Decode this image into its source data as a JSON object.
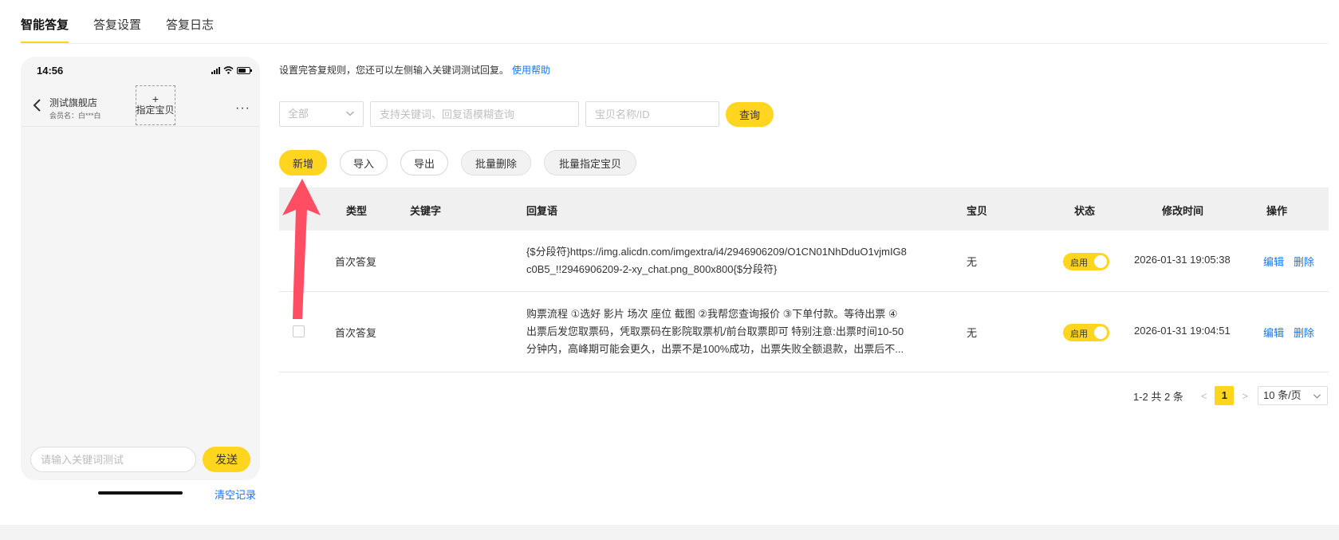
{
  "tabs": [
    {
      "label": "智能答复",
      "active": true
    },
    {
      "label": "答复设置",
      "active": false
    },
    {
      "label": "答复日志",
      "active": false
    }
  ],
  "phone": {
    "time": "14:56",
    "shop_name": "测试旗舰店",
    "member": "会员名：白***白",
    "assign_plus": "+",
    "assign_label": "指定宝贝",
    "more": "···",
    "input_placeholder": "请输入关键词测试",
    "send_label": "发送",
    "clear_label": "清空记录"
  },
  "main": {
    "description": "设置完答复规则，您还可以左侧输入关键词测试回复。",
    "help_link": "使用帮助",
    "filter": {
      "type_select": "全部",
      "keyword_placeholder": "支持关键词、回复语模糊查询",
      "item_placeholder": "宝贝名称/ID",
      "query_label": "查询"
    },
    "actions": {
      "add": "新增",
      "import": "导入",
      "export": "导出",
      "batch_delete": "批量删除",
      "batch_assign": "批量指定宝贝"
    },
    "table": {
      "headers": {
        "type": "类型",
        "keyword": "关键字",
        "reply": "回复语",
        "item": "宝贝",
        "status": "状态",
        "modified": "修改时间",
        "ops": "操作"
      },
      "rows": [
        {
          "type": "首次答复",
          "keyword": "",
          "reply_lines": [
            "{$分段符}https://img.alicdn.com/imgextra/i4/2946906209/O1CN01NhDduO1vjmIG8",
            "c0B5_!!2946906209-2-xy_chat.png_800x800{$分段符}"
          ],
          "item": "无",
          "status": "启用",
          "modified": "2026-01-31 19:05:38",
          "edit": "编辑",
          "delete": "删除"
        },
        {
          "type": "首次答复",
          "keyword": "",
          "reply_lines": [
            "购票流程 ①选好 影片 场次 座位 截图 ②我帮您查询报价 ③下单付款。等待出票 ④",
            "出票后发您取票码，凭取票码在影院取票机/前台取票即可 特别注意:出票时间10-50",
            "分钟内，高峰期可能会更久，出票不是100%成功，出票失败全额退款，出票后不..."
          ],
          "item": "无",
          "status": "启用",
          "modified": "2026-01-31 19:04:51",
          "edit": "编辑",
          "delete": "删除"
        }
      ]
    },
    "pagination": {
      "total": "1-2 共 2 条",
      "prev": "<",
      "current": "1",
      "next": ">",
      "page_size": "10 条/页"
    }
  },
  "colors": {
    "accent": "#ffd51f",
    "link": "#1677ff",
    "annotation": "#ff4d64"
  }
}
